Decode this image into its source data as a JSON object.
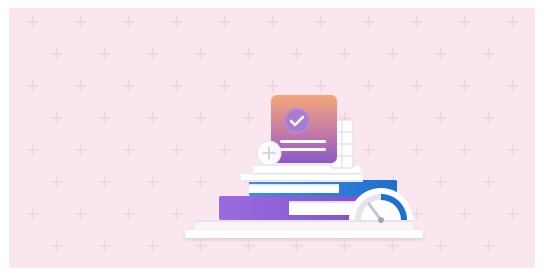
{
  "scene": {
    "background_color": "#f9e6ee",
    "pattern_icon": "plus-icon",
    "badge_icon": "checkmark-icon",
    "add_icon": "plus-circle-icon",
    "gauge_icon": "gauge-icon",
    "colors": {
      "card_top": "#f0a27a",
      "card_bottom": "#8b5cc4",
      "book_purple": "#8a5ad0",
      "book_blue": "#2e7fd8",
      "page_white": "#ffffff"
    }
  }
}
